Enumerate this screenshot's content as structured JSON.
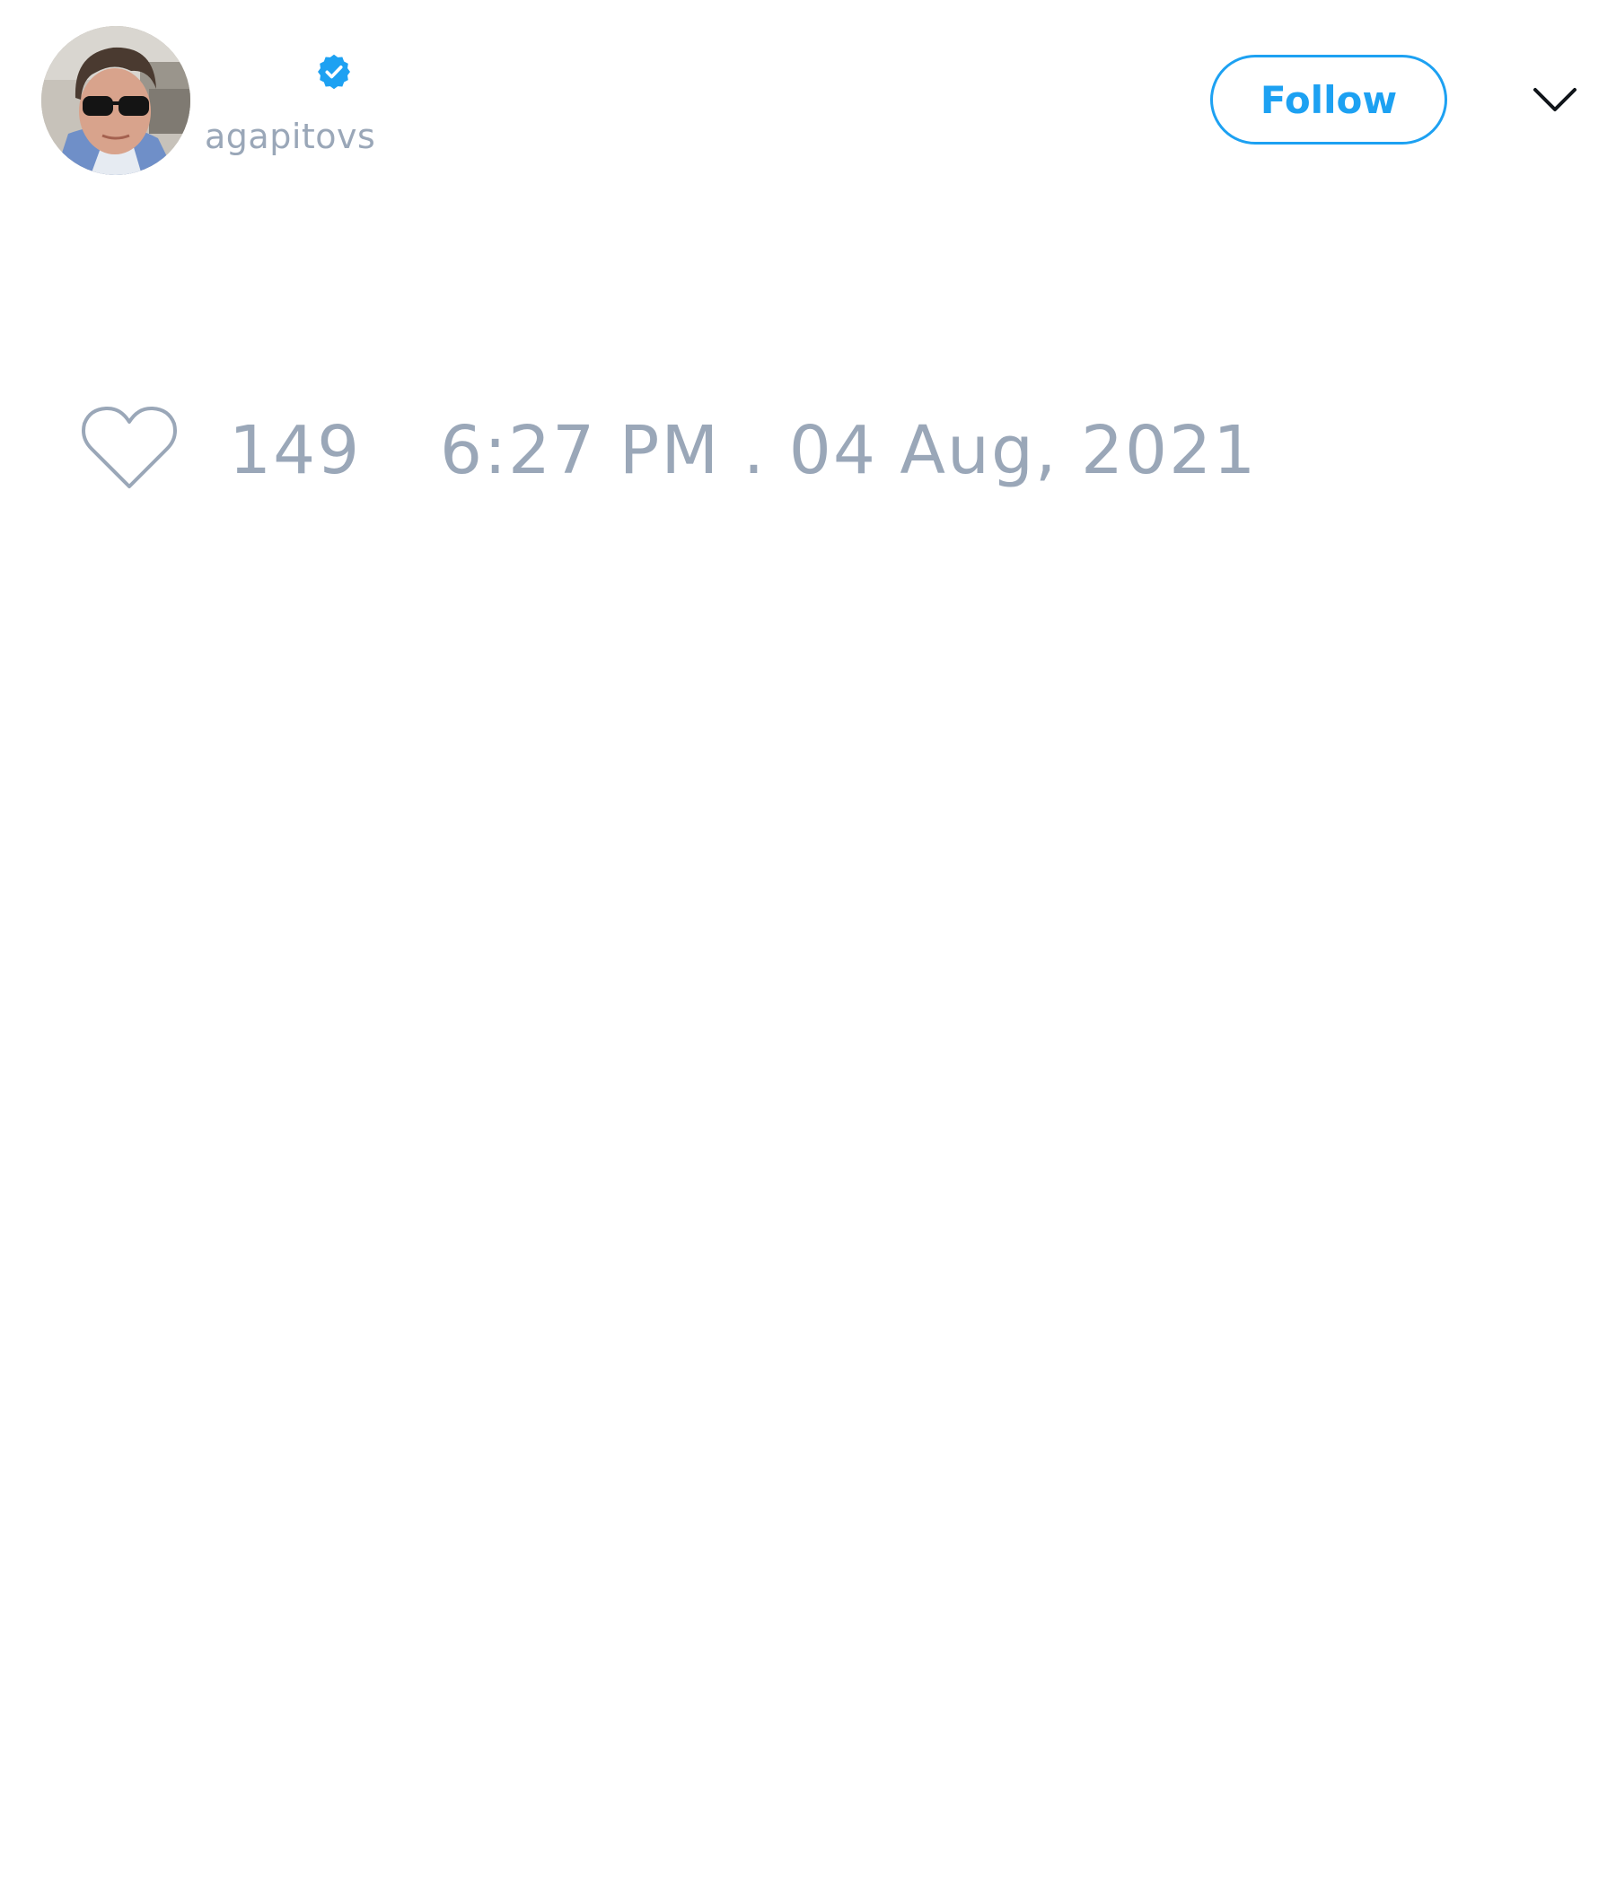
{
  "author": {
    "display_name": "",
    "handle": "agapitovs",
    "verified": true,
    "avatar_icon": "profile-photo"
  },
  "actions": {
    "follow_label": "Follow",
    "menu_icon": "chevron-down-icon"
  },
  "stats": {
    "like_icon": "heart-outline-icon",
    "like_count": "149",
    "timestamp": "6:27 PM . 04 Aug, 2021"
  },
  "colors": {
    "accent": "#1da1f2",
    "muted_text": "#9aa7b8",
    "background": "#ffffff"
  }
}
